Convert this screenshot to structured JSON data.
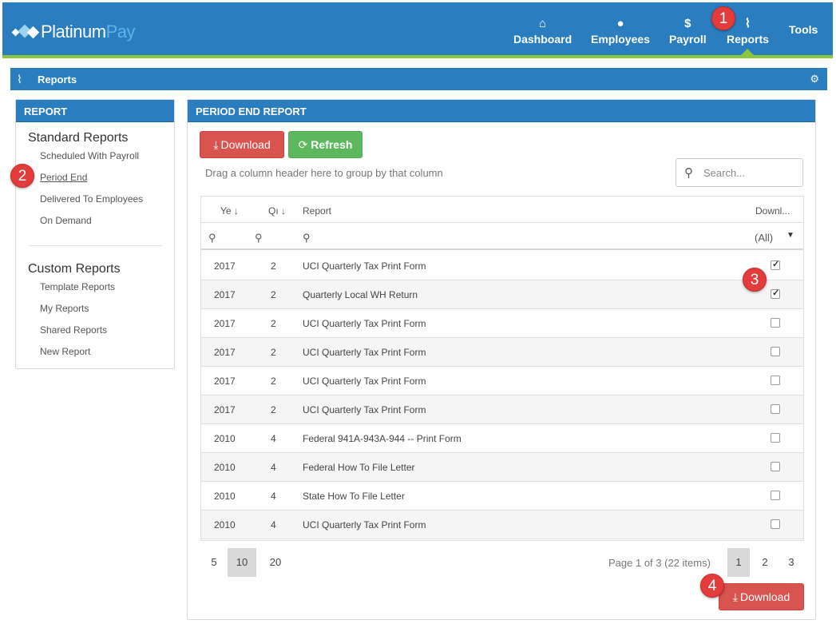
{
  "brand": {
    "name_part1": "Platinum",
    "name_part2": "Pay"
  },
  "nav": {
    "items": [
      {
        "label": "Dashboard",
        "icon": "home-icon",
        "glyph": "⌂"
      },
      {
        "label": "Employees",
        "icon": "user-icon",
        "glyph": "●"
      },
      {
        "label": "Payroll",
        "icon": "dollar-icon",
        "glyph": "$"
      },
      {
        "label": "Reports",
        "icon": "paperclip-icon",
        "glyph": "⌇"
      },
      {
        "label": "Tools",
        "icon": "",
        "glyph": ""
      }
    ],
    "active": "Reports"
  },
  "section": {
    "title": "Reports",
    "clip_glyph": "⌇",
    "gear_glyph": "⚙"
  },
  "badges": [
    "1",
    "2",
    "3",
    "4"
  ],
  "left_panel": {
    "header": "REPORT",
    "standard": {
      "title": "Standard Reports",
      "links": [
        "Scheduled With Payroll",
        "Period End",
        "Delivered To Employees",
        "On Demand"
      ]
    },
    "custom": {
      "title": "Custom Reports",
      "links": [
        "Template Reports",
        "My Reports",
        "Shared Reports",
        "New Report"
      ]
    },
    "active_link": "Period End"
  },
  "main": {
    "header": "PERIOD END REPORT",
    "download_label": "Download",
    "refresh_label": "Refresh",
    "drag_hint": "Drag a column header here to group by that column",
    "search_placeholder": "Search...",
    "columns": {
      "year": "Ye",
      "quarter": "Qı",
      "report": "Report",
      "download": "Downl..."
    },
    "sort_glyph": "↓",
    "filter_all": "(All)",
    "rows": [
      {
        "year": "2017",
        "quarter": "2",
        "report": "UCI Quarterly Tax Print Form",
        "checked": true
      },
      {
        "year": "2017",
        "quarter": "2",
        "report": "Quarterly Local WH Return",
        "checked": true
      },
      {
        "year": "2017",
        "quarter": "2",
        "report": "UCI Quarterly Tax Print Form",
        "checked": false
      },
      {
        "year": "2017",
        "quarter": "2",
        "report": "UCI Quarterly Tax Print Form",
        "checked": false
      },
      {
        "year": "2017",
        "quarter": "2",
        "report": "UCI Quarterly Tax Print Form",
        "checked": false
      },
      {
        "year": "2017",
        "quarter": "2",
        "report": "UCI Quarterly Tax Print Form",
        "checked": false
      },
      {
        "year": "2010",
        "quarter": "4",
        "report": "Federal 941A-943A-944 -- Print Form",
        "checked": false
      },
      {
        "year": "2010",
        "quarter": "4",
        "report": "Federal How To File Letter",
        "checked": false
      },
      {
        "year": "2010",
        "quarter": "4",
        "report": "State How To File Letter",
        "checked": false
      },
      {
        "year": "2010",
        "quarter": "4",
        "report": "UCI Quarterly Tax Print Form",
        "checked": false
      }
    ],
    "page_sizes": [
      "5",
      "10",
      "20"
    ],
    "page_size_selected": "10",
    "page_info": "Page 1 of 3 (22 items)",
    "pages": [
      "1",
      "2",
      "3"
    ],
    "page_selected": "1",
    "bottom_download_label": "Download"
  },
  "colors": {
    "primary": "#2a7ebf",
    "accent_green": "#8dc63f",
    "danger": "#d9534f",
    "success": "#5cb85c",
    "badge": "#e23c3c"
  }
}
